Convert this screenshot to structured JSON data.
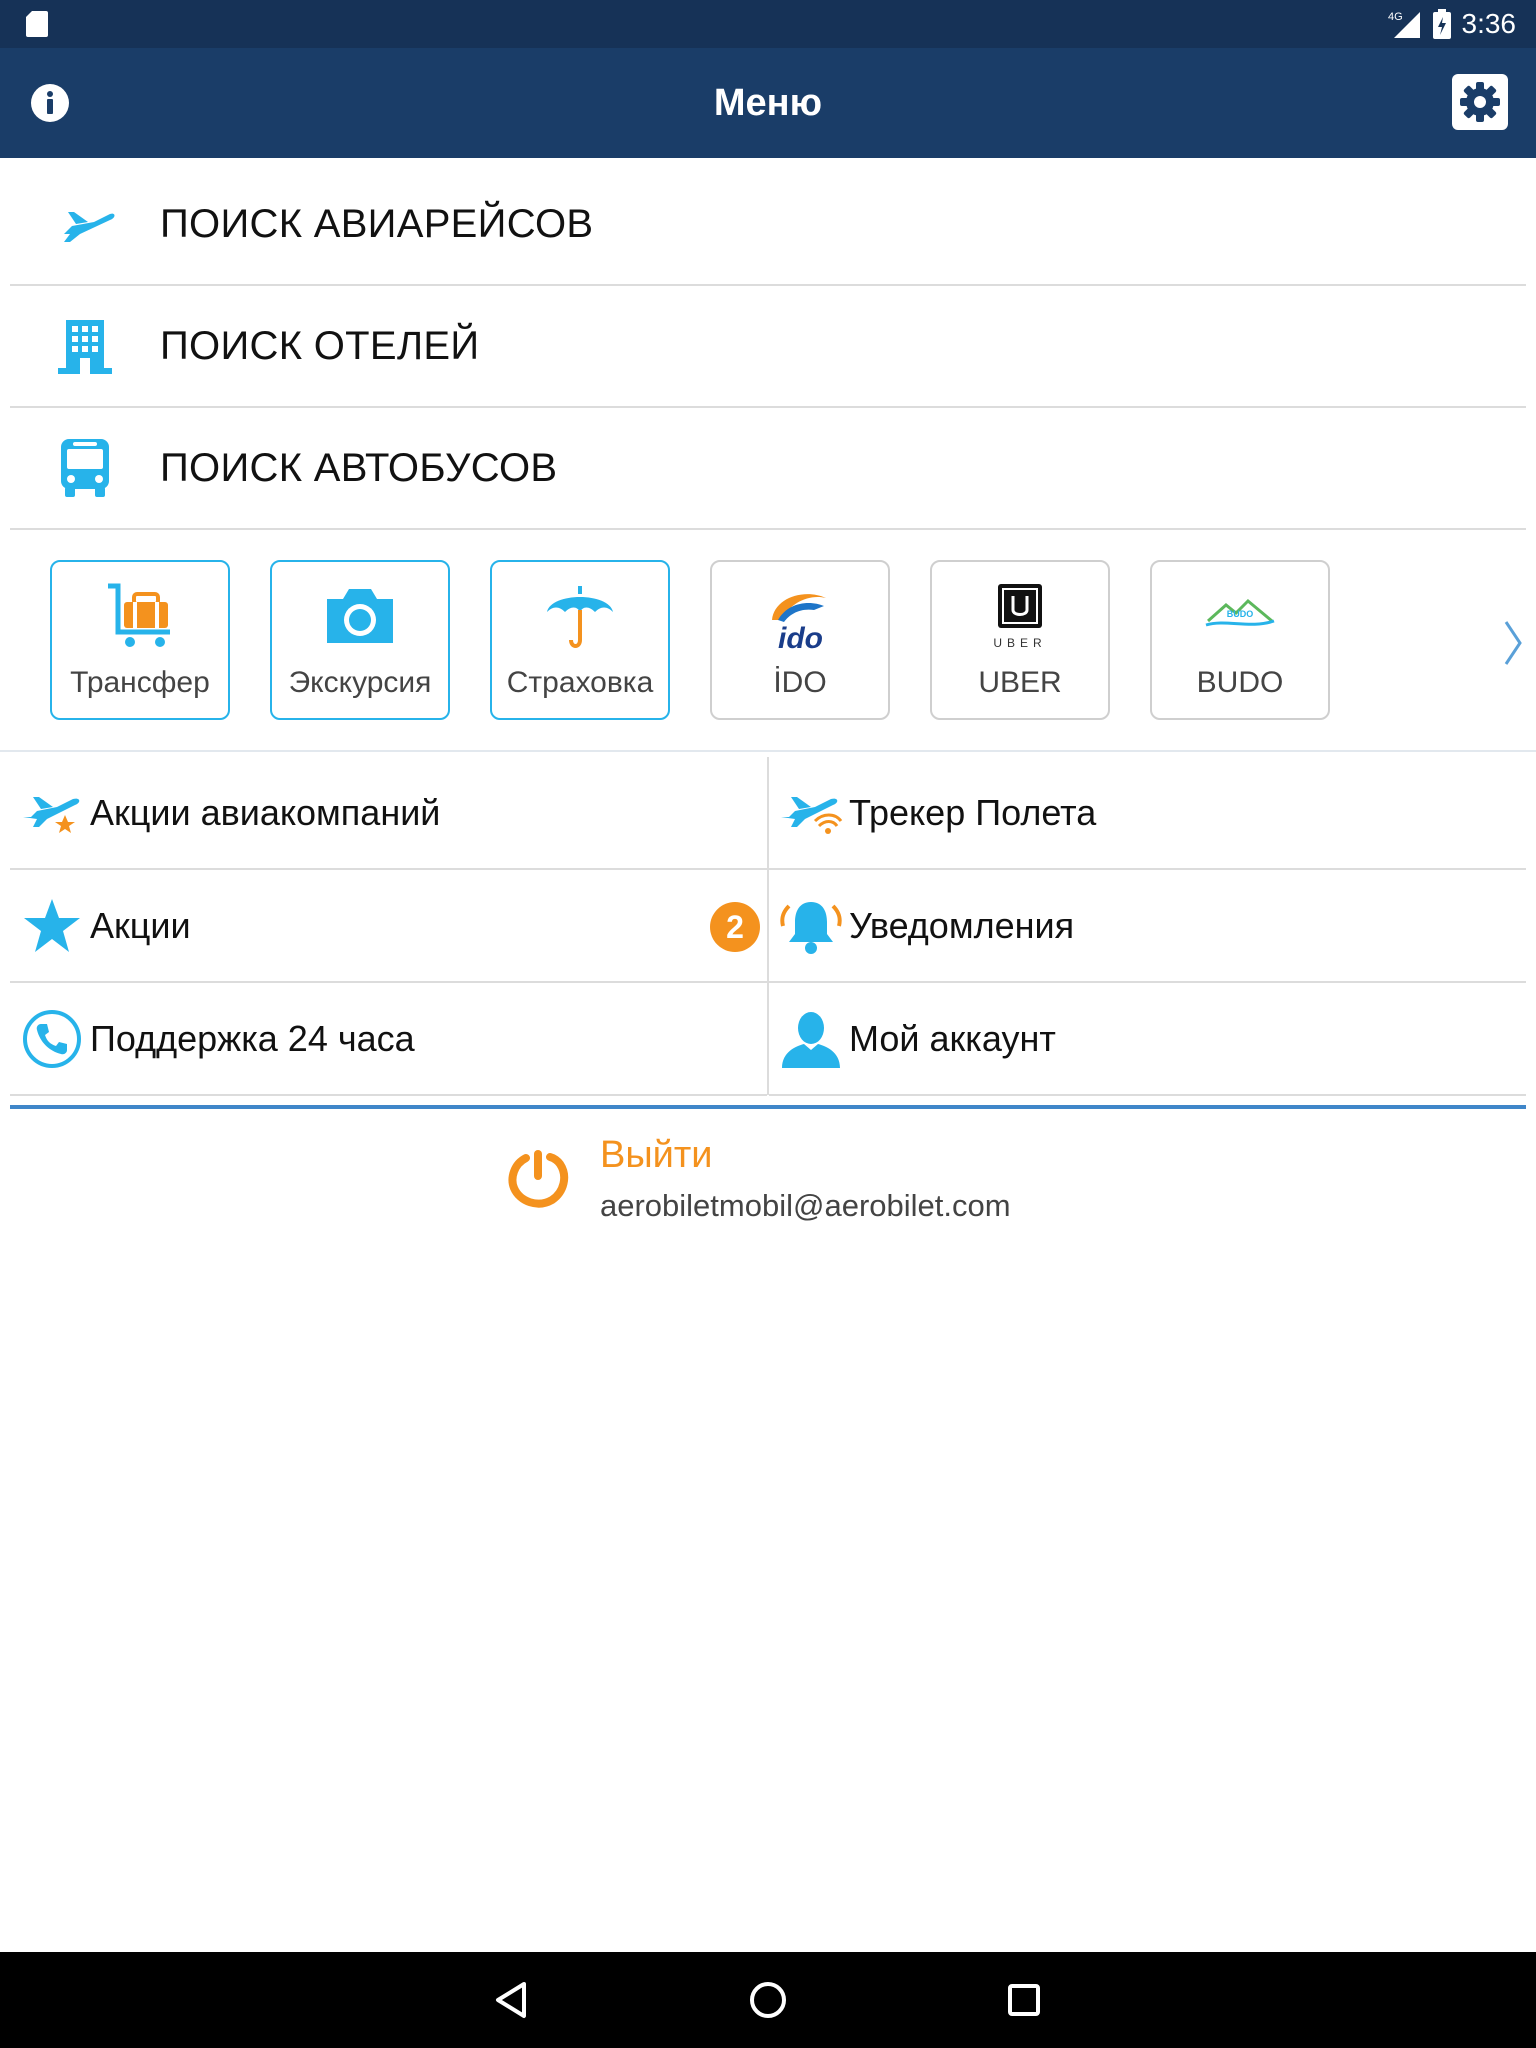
{
  "status_bar": {
    "network": "4G",
    "time": "3:36"
  },
  "app_bar": {
    "title": "Меню",
    "info_icon": "info-icon",
    "settings_icon": "gear-icon"
  },
  "main_menu": [
    {
      "label": "ПОИСК АВИАРЕЙСОВ",
      "icon": "airplane-icon"
    },
    {
      "label": "ПОИСК ОТЕЛЕЙ",
      "icon": "hotel-icon"
    },
    {
      "label": "ПОИСК АВТОБУСОВ",
      "icon": "bus-icon"
    }
  ],
  "services": [
    {
      "label": "Трансфер",
      "icon": "luggage-cart-icon"
    },
    {
      "label": "Экскурсия",
      "icon": "camera-icon"
    },
    {
      "label": "Страховка",
      "icon": "umbrella-icon"
    },
    {
      "label": "İDO",
      "icon": "ido-logo",
      "logo_text": "ido"
    },
    {
      "label": "UBER",
      "icon": "uber-logo",
      "logo_text": "UBER"
    },
    {
      "label": "BUDO",
      "icon": "budo-logo",
      "logo_text": "BUDO"
    }
  ],
  "grid": [
    {
      "label": "Акции авиакомпаний",
      "icon": "airline-star-icon"
    },
    {
      "label": "Трекер Полета",
      "icon": "flight-tracker-icon"
    },
    {
      "label": "Акции",
      "icon": "star-icon",
      "badge": "2"
    },
    {
      "label": "Уведомления",
      "icon": "bell-icon"
    },
    {
      "label": "Поддержка 24 часа",
      "icon": "phone-icon"
    },
    {
      "label": "Мой аккаунт",
      "icon": "user-icon"
    }
  ],
  "logout": {
    "label": "Выйти",
    "email": "aerobiletmobil@aerobilet.com"
  },
  "colors": {
    "primary": "#1a3d68",
    "accent_blue": "#27b3ea",
    "accent_orange": "#f4921e"
  }
}
